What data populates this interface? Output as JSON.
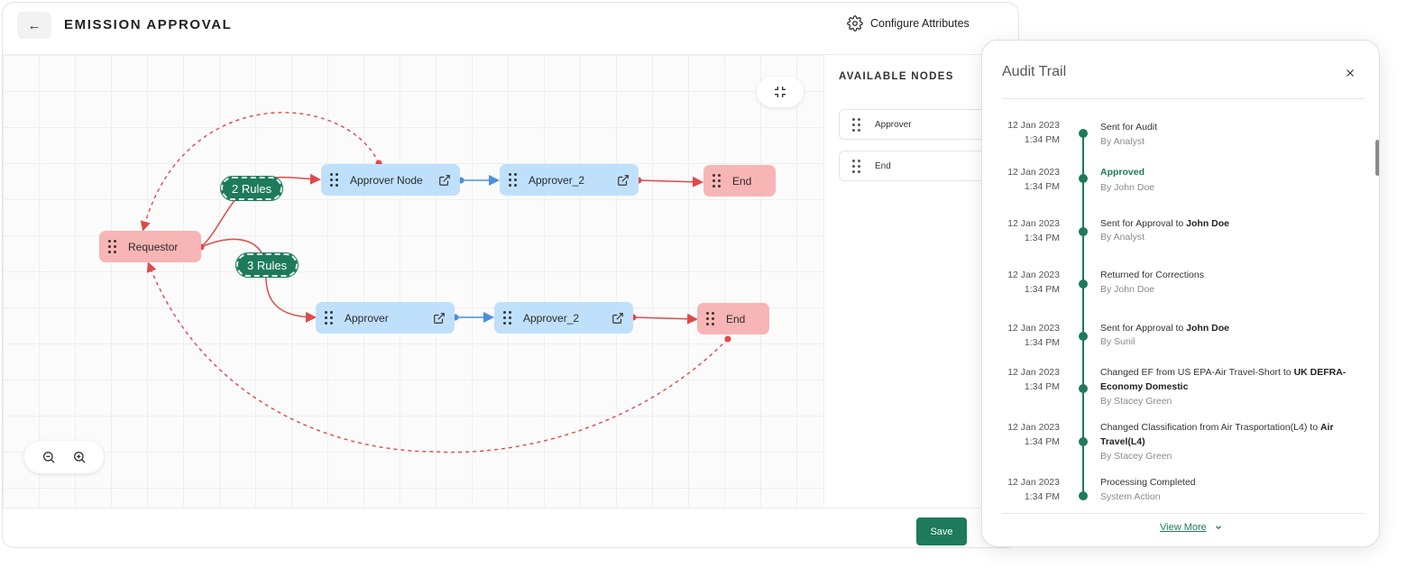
{
  "header": {
    "title": "EMISSION APPROVAL",
    "back_icon": "arrow-left-icon",
    "configure_label": "Configure Attributes"
  },
  "canvas": {
    "nodes": {
      "requestor": "Requestor",
      "approver_node": "Approver Node",
      "approver_2_top": "Approver_2",
      "end_top": "End",
      "approver": "Approver",
      "approver_2_bottom": "Approver_2",
      "end_bottom": "End"
    },
    "rules": {
      "top": "2 Rules",
      "bottom": "3 Rules"
    }
  },
  "side_panel": {
    "title": "AVAILABLE NODES",
    "items": [
      "Approver",
      "End"
    ]
  },
  "footer": {
    "save_label": "Save"
  },
  "audit": {
    "title": "Audit Trail",
    "entries": [
      {
        "date": "12 Jan 2023",
        "time": "1:34 PM",
        "action": "Sent for Audit",
        "by": "By Analyst"
      },
      {
        "date": "12 Jan 2023",
        "time": "1:34 PM",
        "action": "Approved",
        "by": "By John Doe"
      },
      {
        "date": "12 Jan 2023",
        "time": "1:34 PM",
        "action": "Sent for Approval to ",
        "action_bold": "John Doe",
        "by": "By Analyst"
      },
      {
        "date": "12 Jan 2023",
        "time": "1:34 PM",
        "action": "Returned for Corrections",
        "by": "By John Doe"
      },
      {
        "date": "12 Jan 2023",
        "time": "1:34 PM",
        "action": "Sent for Approval to ",
        "action_bold": "John Doe",
        "by": "By Sunil"
      },
      {
        "date": "12 Jan 2023",
        "time": "1:34 PM",
        "action": "Changed EF from US EPA-Air Travel-Short to ",
        "action_bold": "UK DEFRA-Economy Domestic",
        "by": "By Stacey Green"
      },
      {
        "date": "12 Jan 2023",
        "time": "1:34 PM",
        "action": "Changed Classification from Air Trasportation(L4) to ",
        "action_bold": "Air Travel(L4)",
        "by": "By Stacey Green"
      },
      {
        "date": "12 Jan 2023",
        "time": "1:34 PM",
        "action": "Processing Completed",
        "by": "System Action"
      }
    ],
    "view_more": "View More"
  },
  "colors": {
    "accent": "#1d7a5a",
    "node_blue": "#bfe0fb",
    "node_red": "#f8b5b5",
    "edge_red": "#e04848",
    "edge_blue": "#4a8fe0"
  }
}
